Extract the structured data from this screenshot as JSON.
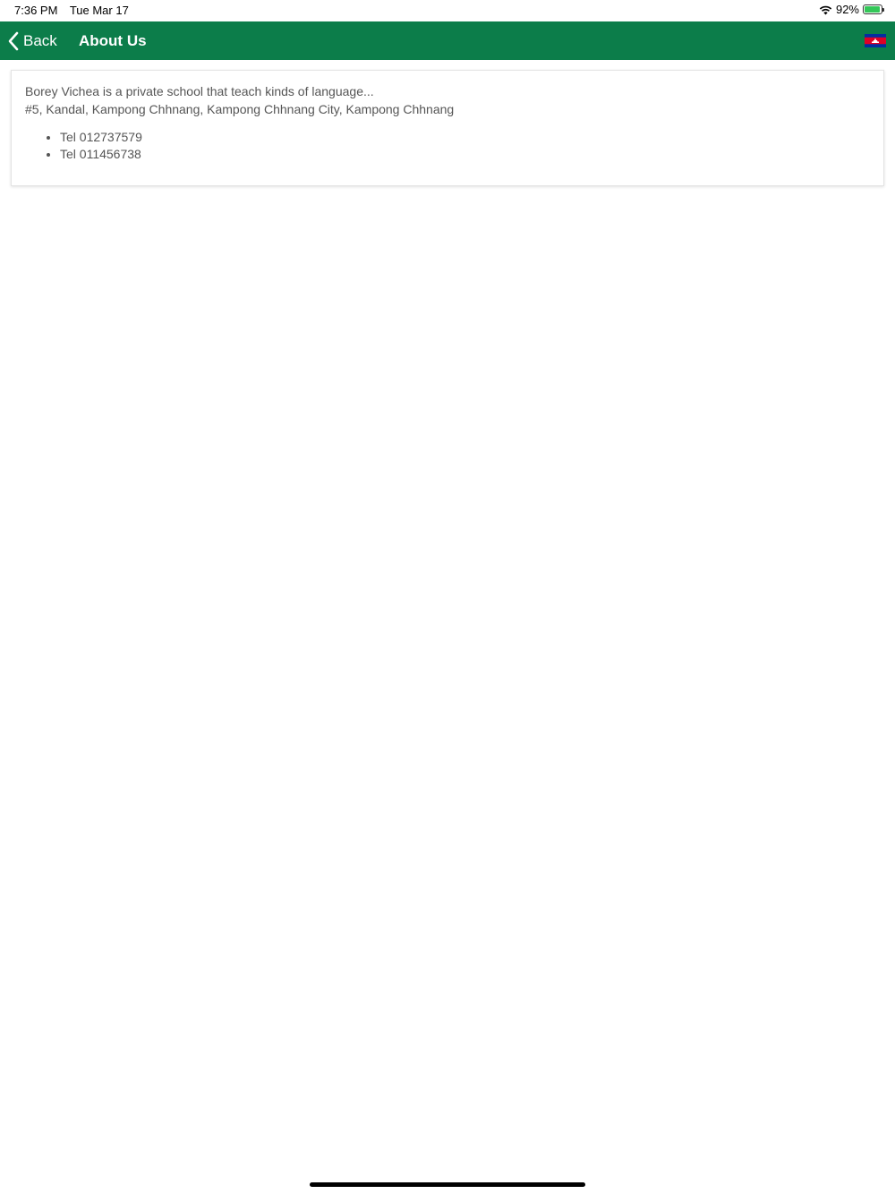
{
  "status_bar": {
    "time": "7:36 PM",
    "date": "Tue Mar 17",
    "battery_percent": "92%",
    "battery_level": 0.92
  },
  "nav": {
    "back_label": "Back",
    "title": "About Us",
    "flag_icon": "cambodia-flag-icon",
    "bar_color": "#0c7d4a"
  },
  "about": {
    "description": "Borey Vichea is a private school that teach kinds of language...",
    "address": "#5, Kandal, Kampong Chhnang, Kampong Chhnang City, Kampong Chhnang",
    "phones": [
      "Tel 012737579",
      "Tel 011456738"
    ]
  }
}
